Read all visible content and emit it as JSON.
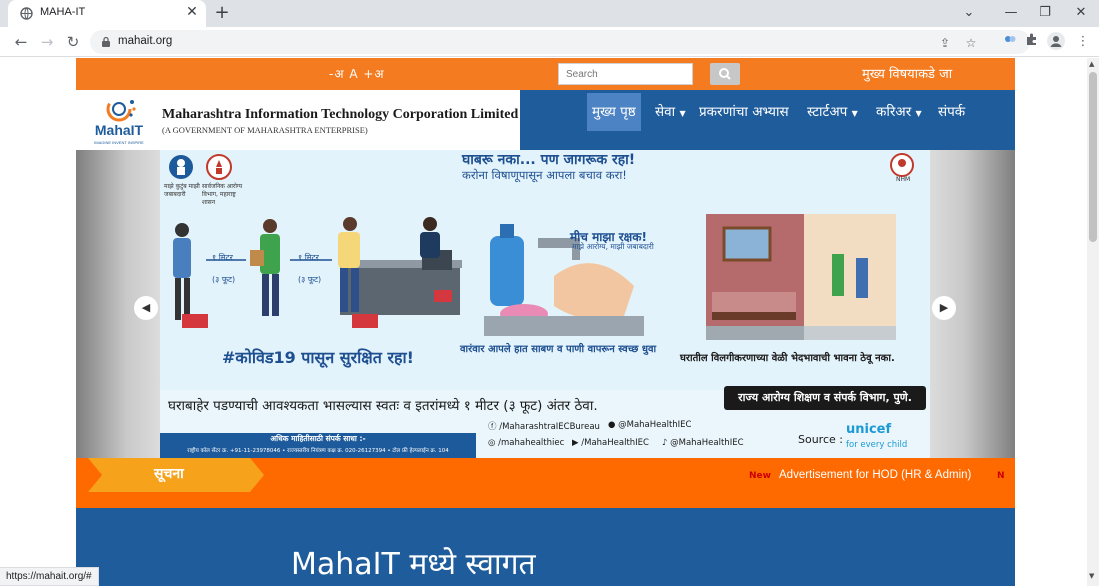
{
  "browser": {
    "tab_title": "MAHA-IT",
    "tab_close": "✕",
    "new_tab": "+",
    "url": "mahait.org",
    "window_min": "—",
    "window_restore": "❐",
    "window_close": "✕",
    "tab_list": "⌄",
    "status_url": "https://mahait.org/#"
  },
  "utility": {
    "font_size_controls": "-अ A +अ",
    "search_placeholder": "Search",
    "skip_link": "मुख्य विषयाकडे जा"
  },
  "brand": {
    "logo_text": "MahaIT",
    "logo_tagline": "IMAGINE INVENT INSPIRE",
    "name": "Maharashtra Information Technology Corporation Limited",
    "subtitle": "(A GOVERNMENT OF MAHARASHTRA ENTERPRISE)"
  },
  "nav": {
    "items": [
      {
        "label": "मुख्य पृष्ठ",
        "active": true,
        "dropdown": false
      },
      {
        "label": "सेवा",
        "active": false,
        "dropdown": true
      },
      {
        "label": "प्रकरणांचा अभ्यास",
        "active": false,
        "dropdown": false
      },
      {
        "label": "स्टार्टअप",
        "active": false,
        "dropdown": true
      },
      {
        "label": "करिअर",
        "active": false,
        "dropdown": true
      },
      {
        "label": "संपर्क",
        "active": false,
        "dropdown": false
      }
    ]
  },
  "slide": {
    "headline": "घाबरू नका... पण जागरूक रहा!",
    "subheadline": "करोना विषाणूपासून आपला बचाव करा!",
    "logo1_caption": "माझे कुटुंब माझी जबाबदारी",
    "logo2_caption": "सार्वजनिक आरोग्य विभाग, महाराष्ट्र शासन",
    "nhm": "NHM",
    "meter_left": "१ मिटर",
    "meter_left_sub": "(३ फूट)",
    "meter_right": "१ मिटर",
    "meter_right_sub": "(३ फूट)",
    "protector": "मीच माझा रक्षक!",
    "protector_sub": "माझे आरोग्य, माझी जबाबदारी",
    "covid_line": "#कोविड19 पासून सुरक्षित रहा!",
    "wash_line": "वारंवार आपले हात साबण व पाणी वापरून स्वच्छ धुवा",
    "isolation_line": "घरातील विलगीकरणाच्या वेळी भेदभावाची भावना ठेवू नका.",
    "distance_line": "घराबाहेर पडण्याची आवश्यकता भासल्यास स्वतः व इतरांमध्ये १ मीटर (३ फूट) अंतर ठेवा.",
    "department": "राज्य आरोग्य शिक्षण व संपर्क विभाग, पुणे.",
    "contact_title": "अधिक माहितीसाठी संपर्क साधा :-",
    "contact_numbers": "राष्ट्रीय कॉल सेंटर क्र. +91-11-23978046 • राज्यस्तरीय नियंत्रण कक्ष क्र. 020-26127394 • टोल फ्री हेल्पलाईन क्र. 104",
    "social_fb": "/MaharashtraIECBureau",
    "social_tw": "@MahaHealthIEC",
    "social_ig": "/mahahealthiec",
    "social_yt": "/MahaHealthIEC",
    "social_tt": "@MahaHealthIEC",
    "source_label": "Source :",
    "unicef": "unicef",
    "unicef_tag": "for every child",
    "prev_arrow": "◀",
    "next_arrow": "▶"
  },
  "notice": {
    "label": "सूचना",
    "new_badge": "New",
    "item": "Advertisement for HOD (HR & Admin)",
    "next_badge": "N"
  },
  "welcome": {
    "title": "MahaIT मध्ये स्वागत"
  },
  "colors": {
    "orange": "#f47b20",
    "nav_blue": "#1e5c9c",
    "notice_orange": "#ff6a00",
    "notice_label": "#f7a21b"
  }
}
